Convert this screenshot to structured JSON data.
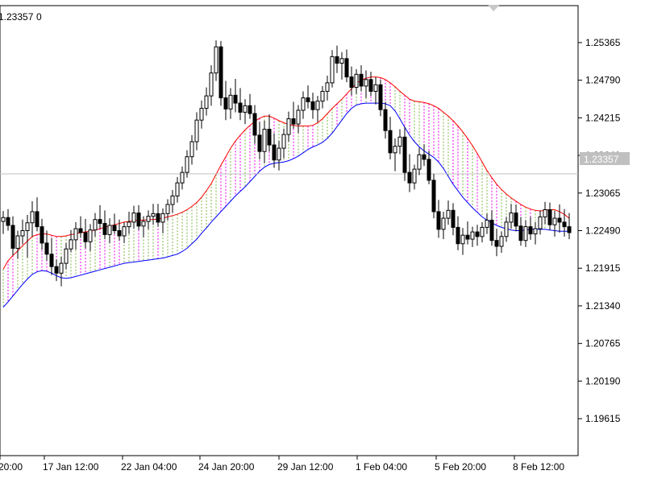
{
  "chart_data": {
    "type": "candlestick",
    "header": {
      "ohlc_readout": "1.23357",
      "volume_readout": "0"
    },
    "price_axis": {
      "ticks": [
        "1.25365",
        "1.24790",
        "1.24215",
        "1.23640",
        "1.23065",
        "1.22490",
        "1.21915",
        "1.21340",
        "1.20765",
        "1.20190",
        "1.19615"
      ],
      "range": [
        1.1905,
        1.2593
      ]
    },
    "time_axis": {
      "ticks": [
        "20:00",
        "17 Jan 12:00",
        "22 Jan 04:00",
        "24 Jan 20:00",
        "29 Jan 12:00",
        "1 Feb 04:00",
        "5 Feb 20:00",
        "8 Feb 12:00"
      ]
    },
    "current_price": {
      "value": 1.23357,
      "label": "1.23357"
    },
    "candle_count": 118,
    "candles": [
      [
        1.2263,
        1.2279,
        1.2244,
        1.2269
      ],
      [
        1.2269,
        1.2282,
        1.2249,
        1.2257
      ],
      [
        1.2257,
        1.2271,
        1.2211,
        1.2222
      ],
      [
        1.2222,
        1.2249,
        1.2206,
        1.2241
      ],
      [
        1.2241,
        1.2266,
        1.2228,
        1.2249
      ],
      [
        1.2249,
        1.2273,
        1.2208,
        1.2261
      ],
      [
        1.2261,
        1.2294,
        1.224,
        1.2278
      ],
      [
        1.2278,
        1.23,
        1.2248,
        1.2255
      ],
      [
        1.2255,
        1.2267,
        1.222,
        1.223
      ],
      [
        1.223,
        1.2249,
        1.2203,
        1.2213
      ],
      [
        1.2213,
        1.2238,
        1.2181,
        1.2194
      ],
      [
        1.2194,
        1.2205,
        1.2172,
        1.2184
      ],
      [
        1.2184,
        1.2209,
        1.2164,
        1.2199
      ],
      [
        1.2199,
        1.223,
        1.219,
        1.2221
      ],
      [
        1.2221,
        1.225,
        1.2216,
        1.2235
      ],
      [
        1.2235,
        1.2262,
        1.222,
        1.2252
      ],
      [
        1.2252,
        1.2271,
        1.2238,
        1.2246
      ],
      [
        1.2246,
        1.2267,
        1.2222,
        1.2232
      ],
      [
        1.2232,
        1.2259,
        1.2218,
        1.225
      ],
      [
        1.225,
        1.2276,
        1.224,
        1.2266
      ],
      [
        1.2266,
        1.2288,
        1.2252,
        1.226
      ],
      [
        1.226,
        1.228,
        1.2236,
        1.2243
      ],
      [
        1.2243,
        1.2268,
        1.223,
        1.2257
      ],
      [
        1.2257,
        1.2275,
        1.2244,
        1.2249
      ],
      [
        1.2249,
        1.2266,
        1.2234,
        1.2241
      ],
      [
        1.2241,
        1.2262,
        1.223,
        1.2255
      ],
      [
        1.2255,
        1.2278,
        1.2244,
        1.2262
      ],
      [
        1.2262,
        1.2287,
        1.2252,
        1.2276
      ],
      [
        1.2276,
        1.2288,
        1.225,
        1.2256
      ],
      [
        1.2256,
        1.2271,
        1.2239,
        1.2263
      ],
      [
        1.2263,
        1.228,
        1.2251,
        1.2271
      ],
      [
        1.2271,
        1.229,
        1.2258,
        1.2275
      ],
      [
        1.2275,
        1.229,
        1.2255,
        1.2262
      ],
      [
        1.2262,
        1.2283,
        1.2245,
        1.2275
      ],
      [
        1.2275,
        1.2297,
        1.2265,
        1.2289
      ],
      [
        1.2289,
        1.2311,
        1.2276,
        1.2302
      ],
      [
        1.2302,
        1.2331,
        1.2292,
        1.2322
      ],
      [
        1.2322,
        1.2347,
        1.2312,
        1.2338
      ],
      [
        1.2338,
        1.2372,
        1.233,
        1.2362
      ],
      [
        1.2362,
        1.2395,
        1.235,
        1.2385
      ],
      [
        1.2385,
        1.243,
        1.2372,
        1.2418
      ],
      [
        1.2418,
        1.2448,
        1.2405,
        1.2436
      ],
      [
        1.2436,
        1.2468,
        1.2425,
        1.2455
      ],
      [
        1.2455,
        1.2502,
        1.244,
        1.249
      ],
      [
        1.249,
        1.254,
        1.2478,
        1.253
      ],
      [
        1.253,
        1.2539,
        1.244,
        1.2452
      ],
      [
        1.2452,
        1.2478,
        1.2418,
        1.2435
      ],
      [
        1.2435,
        1.2467,
        1.242,
        1.2456
      ],
      [
        1.2456,
        1.2481,
        1.243,
        1.2444
      ],
      [
        1.2444,
        1.2467,
        1.2418,
        1.243
      ],
      [
        1.243,
        1.245,
        1.2412,
        1.244
      ],
      [
        1.244,
        1.2458,
        1.242,
        1.2428
      ],
      [
        1.2428,
        1.2441,
        1.2382,
        1.2395
      ],
      [
        1.2395,
        1.2415,
        1.2358,
        1.237
      ],
      [
        1.237,
        1.2417,
        1.2352,
        1.2404
      ],
      [
        1.2404,
        1.2427,
        1.237,
        1.238
      ],
      [
        1.238,
        1.2398,
        1.2345,
        1.2357
      ],
      [
        1.2357,
        1.2386,
        1.2341,
        1.2375
      ],
      [
        1.2375,
        1.2405,
        1.236,
        1.2396
      ],
      [
        1.2396,
        1.2431,
        1.2385,
        1.242
      ],
      [
        1.242,
        1.2446,
        1.2405,
        1.2412
      ],
      [
        1.2412,
        1.2441,
        1.2398,
        1.2433
      ],
      [
        1.2433,
        1.2462,
        1.242,
        1.2452
      ],
      [
        1.2452,
        1.2471,
        1.2436,
        1.2446
      ],
      [
        1.2446,
        1.246,
        1.242,
        1.2434
      ],
      [
        1.2434,
        1.2455,
        1.2415,
        1.2447
      ],
      [
        1.2447,
        1.247,
        1.2436,
        1.2462
      ],
      [
        1.2462,
        1.2486,
        1.2448,
        1.2475
      ],
      [
        1.2475,
        1.2525,
        1.2468,
        1.2515
      ],
      [
        1.2515,
        1.2532,
        1.249,
        1.2505
      ],
      [
        1.2505,
        1.2522,
        1.248,
        1.2512
      ],
      [
        1.2512,
        1.2526,
        1.2476,
        1.2484
      ],
      [
        1.2484,
        1.25,
        1.2456,
        1.2468
      ],
      [
        1.2468,
        1.2496,
        1.2458,
        1.2488
      ],
      [
        1.2488,
        1.2502,
        1.2462,
        1.247
      ],
      [
        1.247,
        1.2494,
        1.2452,
        1.248
      ],
      [
        1.248,
        1.2492,
        1.2455,
        1.2462
      ],
      [
        1.2462,
        1.2484,
        1.2442,
        1.2472
      ],
      [
        1.2472,
        1.248,
        1.2424,
        1.2434
      ],
      [
        1.2434,
        1.2446,
        1.239,
        1.2402
      ],
      [
        1.2402,
        1.2423,
        1.2358,
        1.2368
      ],
      [
        1.2368,
        1.239,
        1.234,
        1.2378
      ],
      [
        1.2378,
        1.2404,
        1.2366,
        1.2392
      ],
      [
        1.2392,
        1.2408,
        1.2325,
        1.2338
      ],
      [
        1.2338,
        1.2366,
        1.2308,
        1.2322
      ],
      [
        1.2322,
        1.235,
        1.2312,
        1.2343
      ],
      [
        1.2343,
        1.2376,
        1.2334,
        1.2365
      ],
      [
        1.2365,
        1.2381,
        1.2348,
        1.2358
      ],
      [
        1.2358,
        1.2371,
        1.232,
        1.2326
      ],
      [
        1.2326,
        1.2336,
        1.2268,
        1.2278
      ],
      [
        1.2278,
        1.2296,
        1.2238,
        1.2251
      ],
      [
        1.2251,
        1.2278,
        1.2236,
        1.2268
      ],
      [
        1.2268,
        1.2295,
        1.2258,
        1.228
      ],
      [
        1.228,
        1.2291,
        1.2242,
        1.2254
      ],
      [
        1.2254,
        1.2271,
        1.2219,
        1.2229
      ],
      [
        1.2229,
        1.2253,
        1.2212,
        1.2242
      ],
      [
        1.2242,
        1.2263,
        1.2228,
        1.2236
      ],
      [
        1.2236,
        1.2255,
        1.2224,
        1.2247
      ],
      [
        1.2247,
        1.2258,
        1.2226,
        1.224
      ],
      [
        1.224,
        1.2262,
        1.2231,
        1.2254
      ],
      [
        1.2254,
        1.2275,
        1.2244,
        1.2265
      ],
      [
        1.2265,
        1.228,
        1.2226,
        1.2234
      ],
      [
        1.2234,
        1.2252,
        1.221,
        1.2225
      ],
      [
        1.2225,
        1.2248,
        1.2215,
        1.224
      ],
      [
        1.224,
        1.227,
        1.2232,
        1.2262
      ],
      [
        1.2262,
        1.229,
        1.2252,
        1.2276
      ],
      [
        1.2276,
        1.2289,
        1.2248,
        1.2256
      ],
      [
        1.2256,
        1.227,
        1.2226,
        1.2234
      ],
      [
        1.2234,
        1.2265,
        1.2224,
        1.2255
      ],
      [
        1.2255,
        1.227,
        1.2235,
        1.2244
      ],
      [
        1.2244,
        1.2262,
        1.2228,
        1.2252
      ],
      [
        1.2252,
        1.228,
        1.2243,
        1.227
      ],
      [
        1.227,
        1.2293,
        1.2259,
        1.2281
      ],
      [
        1.2281,
        1.2292,
        1.225,
        1.2258
      ],
      [
        1.2258,
        1.2279,
        1.224,
        1.2268
      ],
      [
        1.2268,
        1.2289,
        1.2246,
        1.2262
      ],
      [
        1.2262,
        1.2282,
        1.224,
        1.2255
      ],
      [
        1.2255,
        1.2276,
        1.2236,
        1.2246
      ]
    ],
    "bands": {
      "upper_color": "#ff0000",
      "lower_color": "#0000ff",
      "fill_up_color": "#7cb342",
      "fill_down_color": "#ee00ee",
      "upper": [
        1.219,
        1.2203,
        1.2211,
        1.2218,
        1.2226,
        1.2233,
        1.224,
        1.2243,
        1.2244,
        1.2244,
        1.2242,
        1.224,
        1.224,
        1.2241,
        1.2243,
        1.2244,
        1.2246,
        1.2247,
        1.2248,
        1.225,
        1.2252,
        1.2254,
        1.2256,
        1.2258,
        1.226,
        1.2262,
        1.2263,
        1.2264,
        1.2265,
        1.2265,
        1.2266,
        1.2266,
        1.2267,
        1.2268,
        1.227,
        1.2272,
        1.2274,
        1.2277,
        1.2281,
        1.2286,
        1.2292,
        1.23,
        1.231,
        1.2321,
        1.2335,
        1.2349,
        1.2362,
        1.2375,
        1.2386,
        1.2395,
        1.2403,
        1.241,
        1.2416,
        1.2421,
        1.2424,
        1.2424,
        1.2421,
        1.2417,
        1.2414,
        1.2411,
        1.241,
        1.2409,
        1.2409,
        1.2409,
        1.241,
        1.2414,
        1.242,
        1.2428,
        1.2436,
        1.2443,
        1.245,
        1.2458,
        1.2466,
        1.2474,
        1.2479,
        1.2482,
        1.2484,
        1.2484,
        1.2483,
        1.248,
        1.2475,
        1.2469,
        1.2462,
        1.2456,
        1.245,
        1.2447,
        1.2446,
        1.2445,
        1.2443,
        1.244,
        1.2436,
        1.243,
        1.2424,
        1.2417,
        1.2409,
        1.24,
        1.239,
        1.2379,
        1.2367,
        1.2354,
        1.2341,
        1.233,
        1.232,
        1.2312,
        1.2305,
        1.2299,
        1.2294,
        1.2289,
        1.2285,
        1.2282,
        1.228,
        1.2279,
        1.228,
        1.2281,
        1.2281,
        1.2278,
        1.2274,
        1.2268
      ],
      "lower": [
        1.2132,
        1.214,
        1.2149,
        1.2158,
        1.2167,
        1.2175,
        1.2182,
        1.2186,
        1.2188,
        1.2187,
        1.2184,
        1.218,
        1.2177,
        1.2176,
        1.2177,
        1.2179,
        1.2181,
        1.2183,
        1.2185,
        1.2187,
        1.2189,
        1.2191,
        1.2193,
        1.2195,
        1.2197,
        1.2199,
        1.22,
        1.2201,
        1.2202,
        1.2203,
        1.2204,
        1.2205,
        1.2206,
        1.2207,
        1.2209,
        1.2211,
        1.2213,
        1.2217,
        1.2222,
        1.2229,
        1.2236,
        1.2245,
        1.2253,
        1.2262,
        1.227,
        1.2278,
        1.2286,
        1.2294,
        1.2302,
        1.2309,
        1.2316,
        1.2324,
        1.2332,
        1.234,
        1.2346,
        1.235,
        1.2352,
        1.2353,
        1.2354,
        1.2356,
        1.2359,
        1.2363,
        1.2368,
        1.2373,
        1.2377,
        1.238,
        1.2384,
        1.239,
        1.2398,
        1.2408,
        1.2418,
        1.2428,
        1.2436,
        1.2441,
        1.2443,
        1.2444,
        1.2444,
        1.2444,
        1.2444,
        1.2443,
        1.244,
        1.2432,
        1.242,
        1.2407,
        1.2395,
        1.2385,
        1.2377,
        1.2371,
        1.2366,
        1.2361,
        1.2354,
        1.2344,
        1.2332,
        1.232,
        1.231,
        1.23,
        1.2292,
        1.2284,
        1.2277,
        1.227,
        1.2265,
        1.2261,
        1.2257,
        1.2254,
        1.2252,
        1.225,
        1.2249,
        1.2249,
        1.225,
        1.2251,
        1.2251,
        1.2251,
        1.2251,
        1.225,
        1.2249,
        1.2248,
        1.2248,
        1.2248
      ]
    }
  }
}
